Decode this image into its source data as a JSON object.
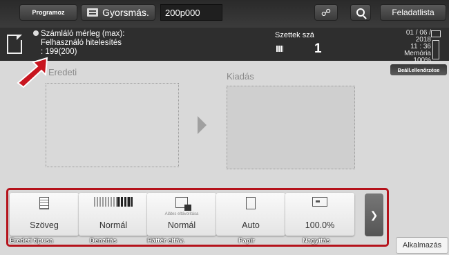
{
  "topbar": {
    "program_label": "Programoz",
    "quick_label": "Gyorsmás.",
    "number_value": "200p000",
    "jobs_label": "Feladatlista"
  },
  "status": {
    "line1": "Számláló mérleg (max):",
    "line2": "Felhasználó hitelesítés",
    "line3": ": 199(200)",
    "sets_label": "Szettek szá",
    "sets_count": "1",
    "date": "01 / 06 / 2018",
    "time": "11 : 36",
    "memory_label": "Memória",
    "memory_value": "100%",
    "check_settings_label": "Beáll.ellenőrzése"
  },
  "main": {
    "original_label": "Eredeti",
    "output_label": "Kiadás"
  },
  "functions": [
    {
      "value": "Szöveg",
      "label": "Eredeti típusa",
      "icon": "document-icon"
    },
    {
      "value": "Normál",
      "label": "Denzitás",
      "icon": "density-icon"
    },
    {
      "value": "Normál",
      "sub": "Alátes eltávolítása",
      "label": "Háttér eltáv.",
      "icon": "background-removal-icon"
    },
    {
      "value": "Auto",
      "label": "Papír",
      "icon": "paper-icon"
    },
    {
      "value": "100.0%",
      "label": "Nagyítás",
      "icon": "zoom-icon"
    }
  ],
  "apps_label": "Alkalmazás",
  "colors": {
    "highlight": "#b5121b",
    "bar_dark": "#2e2e2e"
  }
}
